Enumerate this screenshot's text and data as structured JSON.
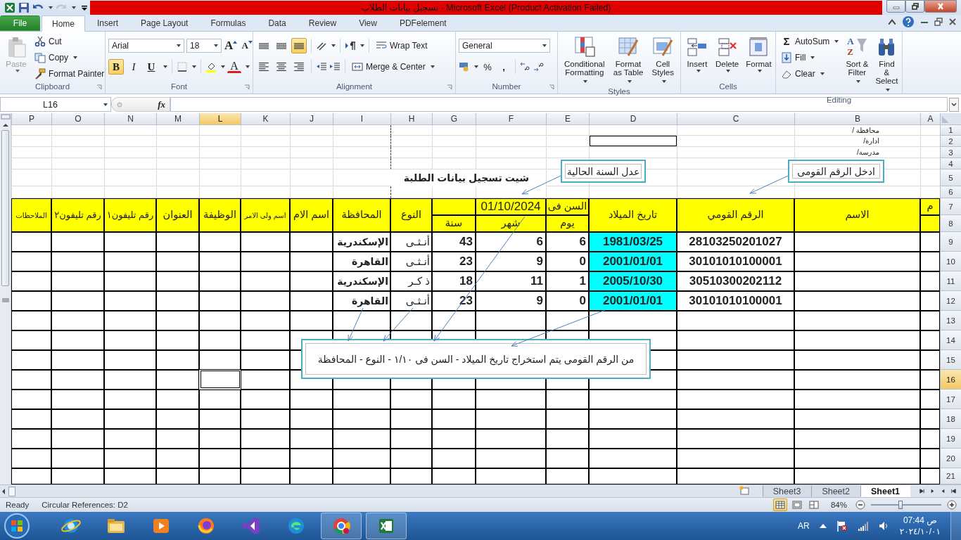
{
  "title_bar": {
    "title": "تسجيل بيانات الطلاب  -  Microsoft Excel (Product Activation Failed)"
  },
  "tabs": [
    {
      "label": "PDFelement",
      "kind": "tab",
      "selected": false
    },
    {
      "label": "View",
      "kind": "tab",
      "selected": false
    },
    {
      "label": "Review",
      "kind": "tab",
      "selected": false
    },
    {
      "label": "Data",
      "kind": "tab",
      "selected": false
    },
    {
      "label": "Formulas",
      "kind": "tab",
      "selected": false
    },
    {
      "label": "Page Layout",
      "kind": "tab",
      "selected": false
    },
    {
      "label": "Insert",
      "kind": "tab",
      "selected": false
    },
    {
      "label": "Home",
      "kind": "tab",
      "selected": true
    },
    {
      "label": "File",
      "kind": "file",
      "selected": false
    }
  ],
  "ribbon": {
    "clipboard": {
      "label": "Clipboard",
      "paste": {
        "label": "Paste",
        "disabled": true
      },
      "cut": "Cut",
      "copy": "Copy",
      "format_painter": "Format Painter"
    },
    "font": {
      "label": "Font",
      "font_name": "Arial",
      "font_size": "18",
      "grow": "A",
      "shrink": "A",
      "font_color": "A",
      "styles": [
        {
          "label": "U",
          "kind": "underline",
          "selected": false
        },
        {
          "label": "I",
          "kind": "italic",
          "selected": false
        },
        {
          "label": "B",
          "kind": "bold",
          "selected": true
        }
      ]
    },
    "alignment": {
      "label": "Alignment",
      "vertical": [
        {
          "selected": false
        },
        {
          "selected": false
        },
        {
          "selected": true
        }
      ],
      "horizontal": [
        {
          "selected": false
        },
        {
          "selected": false
        },
        {
          "selected": false
        }
      ],
      "wrap_text": "Wrap Text",
      "merge_center": "Merge & Center"
    },
    "number": {
      "label": "Number",
      "format": "General",
      "percent": "%",
      "comma": ","
    },
    "styles": {
      "label": "Styles",
      "buttons": [
        "Cell Styles",
        "Format as Table",
        "Conditional Formatting"
      ]
    },
    "cells": {
      "label": "Cells",
      "buttons": [
        "Format",
        "Delete",
        "Insert"
      ]
    },
    "editing": {
      "label": "Editing",
      "sigma": "Σ",
      "autosum": "AutoSum",
      "fill": "Fill",
      "clear": "Clear",
      "sort_letters": [
        "A",
        "Z"
      ],
      "sort_filter": "Sort & Filter",
      "find_select": "Find & Select"
    }
  },
  "formula_bar": {
    "name_box": "L16",
    "function_label": "fx"
  },
  "sheet": {
    "columns": [
      {
        "label": "A",
        "selected": false
      },
      {
        "label": "B",
        "selected": false
      },
      {
        "label": "C",
        "selected": false
      },
      {
        "label": "D",
        "selected": false
      },
      {
        "label": "E",
        "selected": false
      },
      {
        "label": "F",
        "selected": false
      },
      {
        "label": "G",
        "selected": false
      },
      {
        "label": "H",
        "selected": false
      },
      {
        "label": "I",
        "selected": false
      },
      {
        "label": "J",
        "selected": false
      },
      {
        "label": "K",
        "selected": false
      },
      {
        "label": "L",
        "selected": true
      },
      {
        "label": "M",
        "selected": false
      },
      {
        "label": "N",
        "selected": false
      },
      {
        "label": "O",
        "selected": false
      },
      {
        "label": "P",
        "selected": false
      }
    ],
    "rows": [
      {
        "label": "1",
        "selected": false
      },
      {
        "label": "2",
        "selected": false
      },
      {
        "label": "3",
        "selected": false
      },
      {
        "label": "4",
        "selected": false
      },
      {
        "label": "5",
        "selected": false
      },
      {
        "label": "6",
        "selected": false
      },
      {
        "label": "7",
        "selected": false
      },
      {
        "label": "8",
        "selected": false
      },
      {
        "label": "9",
        "selected": false
      },
      {
        "label": "10",
        "selected": false
      },
      {
        "label": "11",
        "selected": false
      },
      {
        "label": "12",
        "selected": false
      },
      {
        "label": "13",
        "selected": false
      },
      {
        "label": "14",
        "selected": false
      },
      {
        "label": "15",
        "selected": false
      },
      {
        "label": "16",
        "selected": true
      },
      {
        "label": "17",
        "selected": false
      },
      {
        "label": "18",
        "selected": false
      },
      {
        "label": "19",
        "selected": false
      },
      {
        "label": "20",
        "selected": false
      },
      {
        "label": "21",
        "selected": false
      }
    ],
    "info_labels": [
      "محافظة /",
      "ادارة/",
      "مدرسة/"
    ],
    "title": "شيت تسجيل بيانات الطلبة",
    "headers": [
      "م",
      "الاسم",
      "الرقم القومي",
      "تاريخ الميلاد",
      "السن فى",
      "يوم",
      "01/10/2024",
      "شهر",
      "سنة",
      "النوع",
      "المحافظة",
      "اسم الام",
      "اسم ولى الامر",
      "الوظيفة",
      "العنوان",
      "رقم تليفون١",
      "رقم تليفون٢",
      "الملاحظات"
    ],
    "records": [
      {
        "national_id": "28103250201027",
        "birth_date": "1981/03/25",
        "day": "6",
        "month": "6",
        "year": "43",
        "gender": "أنـثـى",
        "governorate": "الإسكندرية"
      },
      {
        "national_id": "30101010100001",
        "birth_date": "2001/01/01",
        "day": "0",
        "month": "9",
        "year": "23",
        "gender": "أنـثـى",
        "governorate": "القاهرة"
      },
      {
        "national_id": "30510300202112",
        "birth_date": "2005/10/30",
        "day": "1",
        "month": "11",
        "year": "18",
        "gender": "ذ كـر",
        "governorate": "الإسكندرية"
      },
      {
        "national_id": "30101010100001",
        "birth_date": "2001/01/01",
        "day": "0",
        "month": "9",
        "year": "23",
        "gender": "أنـثـى",
        "governorate": "القاهرة"
      }
    ],
    "callouts": [
      "ادخل الرقم القومى",
      "عدل السنة الحالية",
      "من الرقم القومى يتم استخراج تاريخ الميلاد - السن فى ١/١٠  - النوع - المحافظة"
    ]
  },
  "sheet_tabs": [
    {
      "label": "Sheet1",
      "selected": true
    },
    {
      "label": "Sheet2",
      "selected": false
    },
    {
      "label": "Sheet3",
      "selected": false
    }
  ],
  "status_bar": {
    "ready": "Ready",
    "circular": "Circular References: D2",
    "views": [
      {
        "selected": true
      },
      {
        "selected": false
      },
      {
        "selected": false
      }
    ],
    "zoom": "84%",
    "zoom_slider": {
      "level": 0.42
    }
  },
  "taskbar": {
    "language": "AR",
    "time": "07:44 ص",
    "date": "٢٠٢٤/١٠/٠١"
  }
}
